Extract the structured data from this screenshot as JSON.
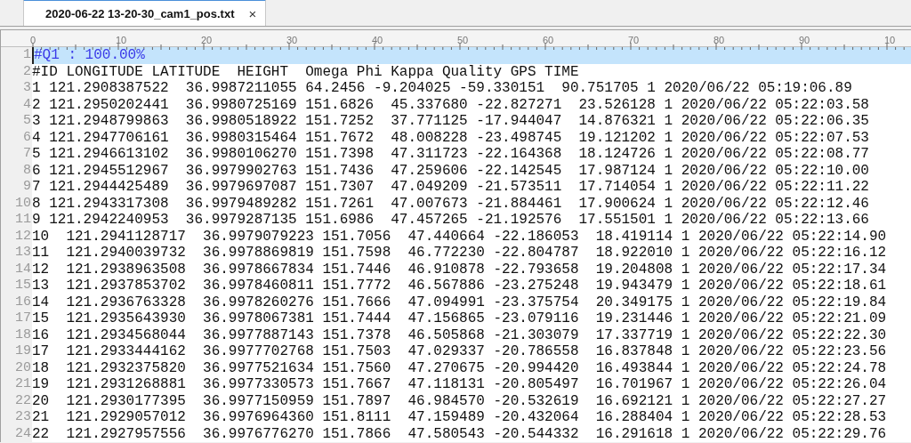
{
  "tabs": [
    {
      "label": "2020-06-22 13-20-30_cam1_pos.txt",
      "close": "×",
      "selected": true
    }
  ],
  "ruler": {
    "labels": [
      "0",
      "10",
      "20",
      "30",
      "40",
      "50",
      "60",
      "70",
      "80",
      "90",
      "10"
    ]
  },
  "lines": [
    {
      "number": "1",
      "text": "#Q1 : 100.00%",
      "current": true
    },
    {
      "number": "2",
      "text": "#ID LONGITUDE LATITUDE  HEIGHT  Omega Phi Kappa Quality GPS TIME",
      "current": false
    },
    {
      "number": "3",
      "text": "1 121.2908387522  36.9987211055 64.2456 -9.204025 -59.330151  90.751705 1 2020/06/22 05:19:06.89",
      "current": false
    },
    {
      "number": "4",
      "text": "2 121.2950202441  36.9980725169 151.6826  45.337680 -22.827271  23.526128 1 2020/06/22 05:22:03.58",
      "current": false
    },
    {
      "number": "5",
      "text": "3 121.2948799863  36.9980518922 151.7252  37.771125 -17.944047  14.876321 1 2020/06/22 05:22:06.35",
      "current": false
    },
    {
      "number": "6",
      "text": "4 121.2947706161  36.9980315464 151.7672  48.008228 -23.498745  19.121202 1 2020/06/22 05:22:07.53",
      "current": false
    },
    {
      "number": "7",
      "text": "5 121.2946613102  36.9980106270 151.7398  47.311723 -22.164368  18.124726 1 2020/06/22 05:22:08.77",
      "current": false
    },
    {
      "number": "8",
      "text": "6 121.2945512967  36.9979902763 151.7436  47.259606 -22.142545  17.987124 1 2020/06/22 05:22:10.00",
      "current": false
    },
    {
      "number": "9",
      "text": "7 121.2944425489  36.9979697087 151.7307  47.049209 -21.573511  17.714054 1 2020/06/22 05:22:11.22",
      "current": false
    },
    {
      "number": "10",
      "text": "8 121.2943317308  36.9979489282 151.7261  47.007673 -21.884461  17.900624 1 2020/06/22 05:22:12.46",
      "current": false
    },
    {
      "number": "11",
      "text": "9 121.2942240953  36.9979287135 151.6986  47.457265 -21.192576  17.551501 1 2020/06/22 05:22:13.66",
      "current": false
    },
    {
      "number": "12",
      "text": "10  121.2941128717  36.9979079223 151.7056  47.440664 -22.186053  18.419114 1 2020/06/22 05:22:14.90",
      "current": false
    },
    {
      "number": "13",
      "text": "11  121.2940039732  36.9978869819 151.7598  46.772230 -22.804787  18.922010 1 2020/06/22 05:22:16.12",
      "current": false
    },
    {
      "number": "14",
      "text": "12  121.2938963508  36.9978667834 151.7446  46.910878 -22.793658  19.204808 1 2020/06/22 05:22:17.34",
      "current": false
    },
    {
      "number": "15",
      "text": "13  121.2937853702  36.9978460811 151.7772  46.567886 -23.275248  19.943479 1 2020/06/22 05:22:18.61",
      "current": false
    },
    {
      "number": "16",
      "text": "14  121.2936763328  36.9978260276 151.7666  47.094991 -23.375754  20.349175 1 2020/06/22 05:22:19.84",
      "current": false
    },
    {
      "number": "17",
      "text": "15  121.2935643930  36.9978067381 151.7444  47.156865 -23.079116  19.231446 1 2020/06/22 05:22:21.09",
      "current": false
    },
    {
      "number": "18",
      "text": "16  121.2934568044  36.9977887143 151.7378  46.505868 -21.303079  17.337719 1 2020/06/22 05:22:22.30",
      "current": false
    },
    {
      "number": "19",
      "text": "17  121.2933444162  36.9977702768 151.7503  47.029337 -20.786558  16.837848 1 2020/06/22 05:22:23.56",
      "current": false
    },
    {
      "number": "20",
      "text": "18  121.2932375820  36.9977521634 151.7560  47.270675 -20.994420  16.493844 1 2020/06/22 05:22:24.78",
      "current": false
    },
    {
      "number": "21",
      "text": "19  121.2931268881  36.9977330573 151.7667  47.118131 -20.805497  16.701967 1 2020/06/22 05:22:26.04",
      "current": false
    },
    {
      "number": "22",
      "text": "20  121.2930177395  36.9977150959 151.7897  46.984570 -20.532619  16.692121 1 2020/06/22 05:22:27.27",
      "current": false
    },
    {
      "number": "23",
      "text": "21  121.2929057012  36.9976964360 151.8111  47.159489 -20.432064  16.288404 1 2020/06/22 05:22:28.53",
      "current": false
    },
    {
      "number": "24",
      "text": "22  121.2927957556  36.9976776270 151.7866  47.580543 -20.544332  16.291618 1 2020/06/22 05:22:29.76",
      "current": false
    }
  ]
}
